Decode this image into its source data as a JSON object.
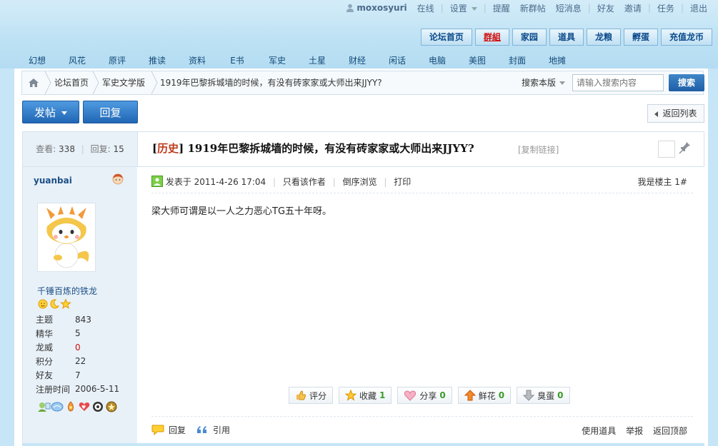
{
  "userbar": {
    "username": "moxosyuri",
    "items": [
      "在线",
      "设置",
      "提醒",
      "新群帖",
      "短消息",
      "好友",
      "邀请",
      "任务",
      "退出"
    ]
  },
  "top_tabs": [
    {
      "label": "论坛首页"
    },
    {
      "label": "群組"
    },
    {
      "label": "家园"
    },
    {
      "label": "道具"
    },
    {
      "label": "龙粮"
    },
    {
      "label": "孵蛋"
    },
    {
      "label": "充值龙币"
    }
  ],
  "category_nav": [
    "幻想",
    "风花",
    "原评",
    "推读",
    "资料",
    "E书",
    "军史",
    "土星",
    "财经",
    "闲话",
    "电脑",
    "美图",
    "封面",
    "地摊"
  ],
  "breadcrumb": {
    "items": [
      "论坛首页",
      "军史文学版",
      "1919年巴黎拆城墙的时候，有没有砖家家或大师出来JJYY?"
    ],
    "search_scope": "搜索本版",
    "search_placeholder": "请输入搜索内容",
    "search_button": "搜索"
  },
  "actions": {
    "post": "发帖",
    "reply": "回复",
    "back_to_list": "返回列表"
  },
  "thread": {
    "views_label": "查看:",
    "views": "338",
    "replies_label": "回复:",
    "replies": "15",
    "tag": "历史",
    "title": "1919年巴黎拆城墙的时候，有没有砖家家或大师出来JJYY?",
    "copy_link": "[复制链接]"
  },
  "author": {
    "name": "yuanbai",
    "user_title": "千锤百炼的铁龙",
    "stats": [
      {
        "k": "主题",
        "v": "843"
      },
      {
        "k": "精华",
        "v": "5"
      },
      {
        "k": "龙威",
        "v": "0"
      },
      {
        "k": "积分",
        "v": "22"
      },
      {
        "k": "好友",
        "v": "7"
      },
      {
        "k": "注册时间",
        "v": "2006-5-11"
      }
    ]
  },
  "post": {
    "posted_at": "发表于 2011-4-26 17:04",
    "only_author": "只看该作者",
    "reverse": "倒序浏览",
    "print": "打印",
    "floor": "我是楼主 1#",
    "content": "梁大师可谓是以一人之力恶心TG五十年呀。",
    "buttons": [
      {
        "label": "评分",
        "count": ""
      },
      {
        "label": "收藏",
        "count": "1"
      },
      {
        "label": "分享",
        "count": "0"
      },
      {
        "label": "鲜花",
        "count": "0"
      },
      {
        "label": "臭蛋",
        "count": "0"
      }
    ],
    "footer": {
      "reply": "回复",
      "quote": "引用",
      "use_item": "使用道具",
      "report": "举报",
      "back_top": "返回顶部"
    }
  },
  "colors": {
    "accent": "#2066b4",
    "link": "#1d4f86",
    "tag": "#c0391b",
    "count": "#3a9b2a"
  }
}
